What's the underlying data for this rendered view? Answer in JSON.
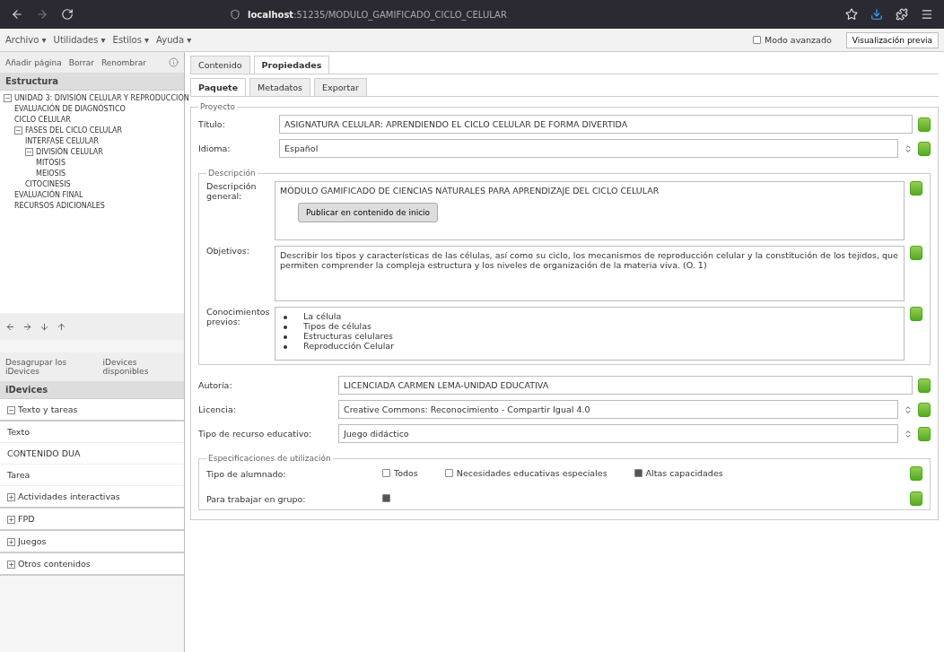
{
  "browser": {
    "url_host": "localhost",
    "url_path": ":51235/MODULO_GAMIFICADO_CICLO_CELULAR"
  },
  "menu": [
    {
      "label": "Archivo ▾"
    },
    {
      "label": "Utilidades ▾"
    },
    {
      "label": "Estilos ▾"
    },
    {
      "label": "Ayuda ▾"
    }
  ],
  "advanced_mode": {
    "label": "Modo avanzado",
    "checked": false
  },
  "preview_button": "Visualización previa",
  "structure": {
    "actions": [
      "Añadir página",
      "Borrar",
      "Renombrar"
    ],
    "title": "Estructura",
    "tree": [
      {
        "label": "UNIDAD 3: DIVISIÓN CELULAR Y REPRODUCCIÓN",
        "expanded": true,
        "selected": false,
        "children": [
          {
            "label": "EVALUACIÓN DE DIAGNÓSTICO",
            "selected": false
          },
          {
            "label": "CICLO CELULAR",
            "selected": false
          },
          {
            "label": "FASES DEL CICLO CELULAR",
            "expanded": true,
            "selected": false,
            "children": [
              {
                "label": "INTERFASE CELULAR",
                "selected": false
              },
              {
                "label": "DIVISIÓN CELULAR",
                "expanded": true,
                "selected": false,
                "children": [
                  {
                    "label": "MITOSIS",
                    "selected": false
                  },
                  {
                    "label": "MEIOSIS",
                    "selected": false
                  }
                ]
              },
              {
                "label": "CITOCINESIS",
                "selected": false
              }
            ]
          },
          {
            "label": "EVALUACIÓN FINAL",
            "selected": false
          },
          {
            "label": "RECURSOS ADICIONALES",
            "selected": false
          }
        ]
      }
    ]
  },
  "idevices": {
    "links": [
      "Desagrupar los iDevices",
      "iDevices disponibles"
    ],
    "title": "iDevices",
    "groups": [
      {
        "label": "Texto y tareas",
        "expanded": true,
        "items": [
          "Texto",
          "CONTENIDO DUA",
          "Tarea"
        ]
      },
      {
        "label": "Actividades interactivas",
        "expanded": false
      },
      {
        "label": "FPD",
        "expanded": false
      },
      {
        "label": "Juegos",
        "expanded": false
      },
      {
        "label": "Otros contenidos",
        "expanded": false
      }
    ]
  },
  "tabs": [
    {
      "label": "Contenido",
      "selected": false
    },
    {
      "label": "Propiedades",
      "selected": true
    }
  ],
  "subtabs": [
    {
      "label": "Paquete",
      "selected": true
    },
    {
      "label": "Metadatos",
      "selected": false
    },
    {
      "label": "Exportar",
      "selected": false
    }
  ],
  "project": {
    "legend": "Proyecto",
    "title_label": "Título:",
    "title_value": "ASIGNATURA CELULAR: APRENDIENDO EL CICLO CELULAR DE FORMA DIVERTIDA",
    "language_label": "Idioma:",
    "language_value": "Español"
  },
  "description": {
    "legend": "Descripción",
    "general_label": "Descripción general:",
    "general_value": "MÓDULO GAMIFICADO DE CIENCIAS NATURALES PARA APRENDIZAJE DEL CICLO CELULAR",
    "insert_button": "Publicar en contenido de inicio",
    "objectives_label": "Objetivos:",
    "objectives_value": "Describir los tipos y características de las células, así como su ciclo, los mecanismos de reproducción celular y la constitución de los tejidos, que permiten comprender la compleja estructura y los niveles de organización de la materia viva. (O. 1)",
    "prior_label": "Conocimientos previos:",
    "prior_items": [
      "La célula",
      "Tipos de células",
      "Estructuras celulares",
      "Reproducción Celular"
    ]
  },
  "authorship_label": "Autoría:",
  "authorship_value": "LICENCIADA CARMEN LEMA-UNIDAD EDUCATIVA",
  "license_label": "Licencia:",
  "license_value": "Creative Commons: Reconocimiento - Compartir Igual 4.0",
  "resource_label": "Tipo de recurso educativo:",
  "resource_value": "Juego didáctico",
  "usage": {
    "legend": "Especificaciones de utilización",
    "students_label": "Tipo de alumnado:",
    "options": [
      {
        "label": "Todos",
        "checked": false
      },
      {
        "label": "Necesidades educativas especiales",
        "checked": false
      },
      {
        "label": "Altas capacidades",
        "checked": true
      }
    ],
    "group_label": "Para trabajar en grupo:",
    "group_checked": true
  }
}
